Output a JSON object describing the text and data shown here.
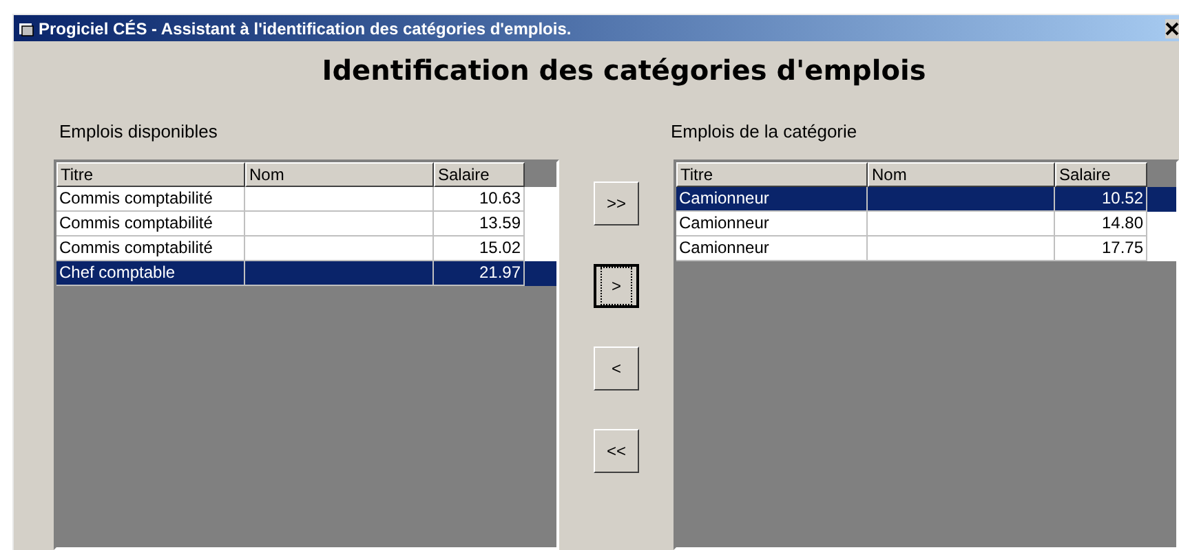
{
  "window": {
    "title": "Progiciel CÉS - Assistant à l'identification des catégories d'emplois."
  },
  "heading": "Identification des catégories d'emplois",
  "available": {
    "label": "Emplois disponibles",
    "columns": [
      "Titre",
      "Nom",
      "Salaire"
    ],
    "rows": [
      {
        "cells": [
          "Commis comptabilité",
          "",
          "10.63"
        ],
        "selected": false
      },
      {
        "cells": [
          "Commis comptabilité",
          "",
          "13.59"
        ],
        "selected": false
      },
      {
        "cells": [
          "Commis comptabilité",
          "",
          "15.02"
        ],
        "selected": false
      },
      {
        "cells": [
          "Chef comptable",
          "",
          "21.97"
        ],
        "selected": true
      }
    ]
  },
  "buttons": [
    {
      "label": ">>",
      "focused": false
    },
    {
      "label": ">",
      "focused": true
    },
    {
      "label": "<",
      "focused": false
    },
    {
      "label": "<<",
      "focused": false
    }
  ],
  "category": {
    "label": "Emplois de la catégorie",
    "columns": [
      "Titre",
      "Nom",
      "Salaire"
    ],
    "rows": [
      {
        "cells": [
          "Camionneur",
          "",
          "10.52"
        ],
        "selected": true
      },
      {
        "cells": [
          "Camionneur",
          "",
          "14.80"
        ],
        "selected": false
      },
      {
        "cells": [
          "Camionneur",
          "",
          "17.75"
        ],
        "selected": false
      }
    ]
  }
}
